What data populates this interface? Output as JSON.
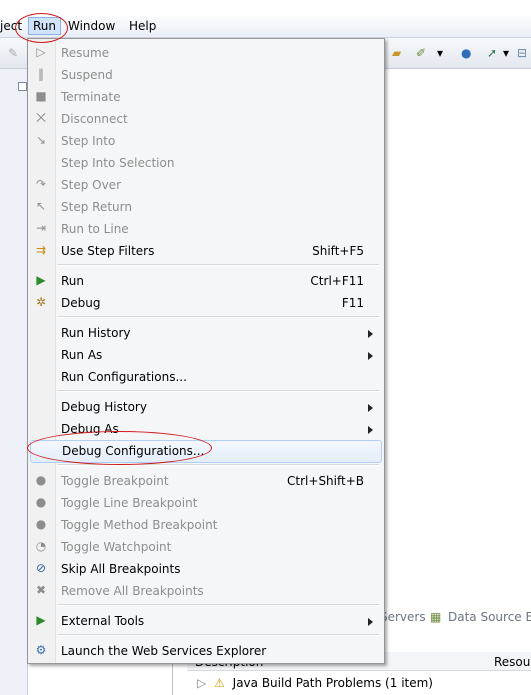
{
  "menubar": {
    "partial_left": "ject",
    "run": "Run",
    "window": "Window",
    "help": "Help"
  },
  "run_menu": {
    "items": [
      {
        "label": "Resume",
        "icon": "resume-icon",
        "glyph": "▷",
        "shortcut": "",
        "submenu": false,
        "enabled": false
      },
      {
        "label": "Suspend",
        "icon": "suspend-icon",
        "glyph": "‖",
        "shortcut": "",
        "submenu": false,
        "enabled": false
      },
      {
        "label": "Terminate",
        "icon": "terminate-icon",
        "glyph": "■",
        "shortcut": "",
        "submenu": false,
        "enabled": false
      },
      {
        "label": "Disconnect",
        "icon": "disconnect-icon",
        "glyph": "⨉",
        "shortcut": "",
        "submenu": false,
        "enabled": false
      },
      {
        "label": "Step Into",
        "icon": "step-into-icon",
        "glyph": "↘",
        "shortcut": "",
        "submenu": false,
        "enabled": false
      },
      {
        "label": "Step Into Selection",
        "icon": "",
        "glyph": "",
        "shortcut": "",
        "submenu": false,
        "enabled": false
      },
      {
        "label": "Step Over",
        "icon": "step-over-icon",
        "glyph": "↷",
        "shortcut": "",
        "submenu": false,
        "enabled": false
      },
      {
        "label": "Step Return",
        "icon": "step-return-icon",
        "glyph": "↖",
        "shortcut": "",
        "submenu": false,
        "enabled": false
      },
      {
        "label": "Run to Line",
        "icon": "run-to-line-icon",
        "glyph": "⇥",
        "shortcut": "",
        "submenu": false,
        "enabled": false
      },
      {
        "label": "Use Step Filters",
        "icon": "step-filters-icon",
        "glyph": "⇉",
        "shortcut": "Shift+F5",
        "submenu": false,
        "enabled": true
      },
      {
        "label": "Run",
        "icon": "run-icon",
        "glyph": "▶",
        "shortcut": "Ctrl+F11",
        "submenu": false,
        "enabled": true
      },
      {
        "label": "Debug",
        "icon": "debug-icon",
        "glyph": "✲",
        "shortcut": "F11",
        "submenu": false,
        "enabled": true
      },
      {
        "label": "Run History",
        "icon": "",
        "glyph": "",
        "shortcut": "",
        "submenu": true,
        "enabled": true
      },
      {
        "label": "Run As",
        "icon": "",
        "glyph": "",
        "shortcut": "",
        "submenu": true,
        "enabled": true
      },
      {
        "label": "Run Configurations...",
        "icon": "",
        "glyph": "",
        "shortcut": "",
        "submenu": false,
        "enabled": true
      },
      {
        "label": "Debug History",
        "icon": "",
        "glyph": "",
        "shortcut": "",
        "submenu": true,
        "enabled": true
      },
      {
        "label": "Debug As",
        "icon": "",
        "glyph": "",
        "shortcut": "",
        "submenu": true,
        "enabled": true
      },
      {
        "label": "Debug Configurations...",
        "icon": "",
        "glyph": "",
        "shortcut": "",
        "submenu": false,
        "enabled": true,
        "highlighted": true
      },
      {
        "label": "Toggle Breakpoint",
        "icon": "breakpoint-icon",
        "glyph": "●",
        "shortcut": "Ctrl+Shift+B",
        "submenu": false,
        "enabled": false
      },
      {
        "label": "Toggle Line Breakpoint",
        "icon": "line-breakpoint-icon",
        "glyph": "●",
        "shortcut": "",
        "submenu": false,
        "enabled": false
      },
      {
        "label": "Toggle Method Breakpoint",
        "icon": "method-breakpoint-icon",
        "glyph": "●",
        "shortcut": "",
        "submenu": false,
        "enabled": false
      },
      {
        "label": "Toggle Watchpoint",
        "icon": "watchpoint-icon",
        "glyph": "◔",
        "shortcut": "",
        "submenu": false,
        "enabled": false
      },
      {
        "label": "Skip All Breakpoints",
        "icon": "skip-breakpoints-icon",
        "glyph": "⊘",
        "shortcut": "",
        "submenu": false,
        "enabled": true
      },
      {
        "label": "Remove All Breakpoints",
        "icon": "remove-breakpoints-icon",
        "glyph": "✖",
        "shortcut": "",
        "submenu": false,
        "enabled": false
      },
      {
        "label": "External Tools",
        "icon": "external-tools-icon",
        "glyph": "▶",
        "shortcut": "",
        "submenu": true,
        "enabled": true
      },
      {
        "label": "Launch the Web Services Explorer",
        "icon": "web-services-icon",
        "glyph": "⚙",
        "shortcut": "",
        "submenu": false,
        "enabled": true
      }
    ]
  },
  "background": {
    "tab_servers": "Servers",
    "tab_data_source": "Data Source Exp",
    "col_description": "Description",
    "col_resource": "Resou",
    "row_problem": "Java Build Path Problems (1 item)"
  },
  "colors": {
    "annotation": "#d11919",
    "highlight_border": "#aecff7",
    "disabled_text": "#8d8d8d"
  }
}
